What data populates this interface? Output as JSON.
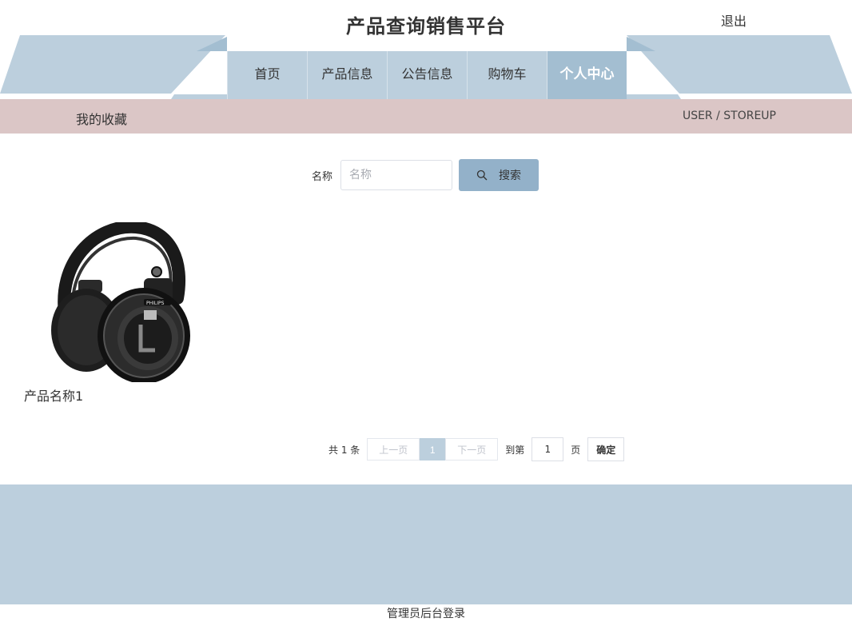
{
  "header": {
    "site_title": "产品查询销售平台",
    "logout_label": "退出"
  },
  "nav": {
    "items": [
      {
        "label": "首页"
      },
      {
        "label": "产品信息"
      },
      {
        "label": "公告信息"
      },
      {
        "label": "购物车"
      },
      {
        "label": "个人中心"
      }
    ],
    "active_index": 4
  },
  "breadcrumb": {
    "title": "我的收藏",
    "en": "USER / STOREUP"
  },
  "search": {
    "label": "名称",
    "placeholder": "名称",
    "value": "",
    "button_label": "搜索",
    "button_icon": "search-icon"
  },
  "products": [
    {
      "name": "产品名称1",
      "image": "headphones-image"
    }
  ],
  "pagination": {
    "total_text": "共 1 条",
    "prev_label": "上一页",
    "current_page": "1",
    "next_label": "下一页",
    "jump_prefix": "到第",
    "jump_value": "1",
    "jump_suffix": "页",
    "confirm_label": "确定"
  },
  "footer": {
    "admin_link": "管理员后台登录"
  },
  "colors": {
    "nav_bg": "#bccfdd",
    "nav_active_bg": "#a3bed1",
    "crumb_bg": "#dbc6c6",
    "button_bg": "#93b1c9",
    "footer_bg": "#bccfdd"
  }
}
